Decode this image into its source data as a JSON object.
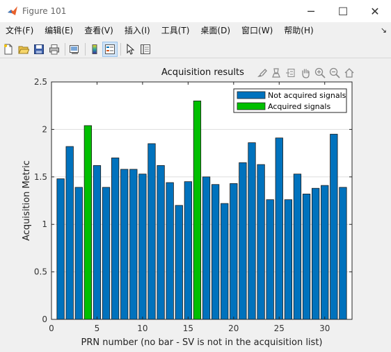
{
  "window": {
    "title": "Figure 101",
    "controls": {
      "minimize": "─",
      "maximize": "☐",
      "close": "✕"
    }
  },
  "menubar": {
    "items": [
      "文件(F)",
      "编辑(E)",
      "查看(V)",
      "插入(I)",
      "工具(T)",
      "桌面(D)",
      "窗口(W)",
      "帮助(H)"
    ],
    "overflow_arrow": "↘"
  },
  "toolbar": {
    "buttons": [
      "new-figure-icon",
      "open-file-icon",
      "save-icon",
      "print-icon",
      "link-plot-icon",
      "colorbar-icon",
      "legend-icon",
      "pointer-icon",
      "property-inspector-icon"
    ],
    "pressed": "legend-icon"
  },
  "axes_toolbar": {
    "buttons": [
      "brush-icon",
      "data-tip-icon",
      "rotate-icon",
      "pan-icon",
      "zoom-in-icon",
      "zoom-out-icon",
      "home-icon"
    ]
  },
  "colors": {
    "not_acquired": "#0072bd",
    "acquired": "#00bf00",
    "grid": "#dedede",
    "axes_bg": "#ffffff"
  },
  "chart_data": {
    "type": "bar",
    "title": "Acquisition results",
    "xlabel": "PRN number (no bar - SV is not in the acquisition list)",
    "ylabel": "Acquisition Metric",
    "xlim": [
      0,
      33
    ],
    "ylim": [
      0,
      2.5
    ],
    "xticks": [
      0,
      5,
      10,
      15,
      20,
      25,
      30
    ],
    "yticks": [
      0,
      0.5,
      1,
      1.5,
      2,
      2.5
    ],
    "grid": "horizontal",
    "legend_position": "top-right",
    "categories": [
      1,
      2,
      3,
      4,
      5,
      6,
      7,
      8,
      9,
      10,
      11,
      12,
      13,
      14,
      15,
      16,
      17,
      18,
      19,
      20,
      21,
      22,
      23,
      24,
      25,
      26,
      27,
      28,
      29,
      30,
      31,
      32
    ],
    "values": [
      1.48,
      1.82,
      1.39,
      2.04,
      1.62,
      1.39,
      1.7,
      1.58,
      1.58,
      1.53,
      1.85,
      1.62,
      1.44,
      1.2,
      1.45,
      2.3,
      1.5,
      1.42,
      1.22,
      1.43,
      1.65,
      1.86,
      1.63,
      1.26,
      1.91,
      1.26,
      1.53,
      1.32,
      1.38,
      1.41,
      1.95,
      1.39
    ],
    "acquired_prns": [
      4,
      16
    ],
    "series": [
      {
        "name": "Not acquired signals",
        "color": "#0072bd"
      },
      {
        "name": "Acquired signals",
        "color": "#00bf00"
      }
    ]
  }
}
